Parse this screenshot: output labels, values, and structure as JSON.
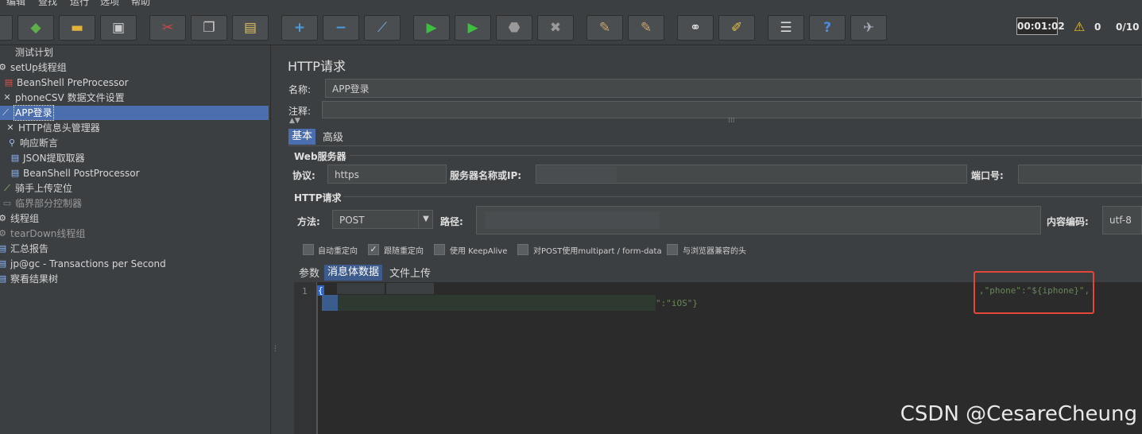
{
  "menu": {
    "items": [
      "编辑",
      "查找",
      "运行",
      "选项",
      "帮助"
    ]
  },
  "toolbar": {
    "buttons": [
      "new-icon",
      "templates-icon",
      "open-icon",
      "save-icon",
      "cut-icon",
      "copy-icon",
      "paste-icon",
      "expand-icon",
      "collapse-icon",
      "toggle-icon",
      "start-icon",
      "start-no-pause-icon",
      "stop-icon",
      "shutdown-icon",
      "clear-icon",
      "clear-all-icon",
      "search-icon",
      "reset-search-icon",
      "function-helper-icon",
      "help-icon",
      "remote-icon"
    ],
    "timer": "00:01:02",
    "warnings": "0",
    "threads": "0/10"
  },
  "tree": {
    "items": [
      {
        "label": "测试计划",
        "icon": "test-plan-icon"
      },
      {
        "label": "setUp线程组",
        "icon": "gear-icon"
      },
      {
        "label": "BeanShell PreProcessor",
        "icon": "script-icon"
      },
      {
        "label": "phoneCSV 数据文件设置",
        "icon": "tools-icon"
      },
      {
        "label": "APP登录",
        "icon": "pipette-icon",
        "selected": true
      },
      {
        "label": "HTTP信息头管理器",
        "icon": "tools-icon"
      },
      {
        "label": "响应断言",
        "icon": "magnifier-icon"
      },
      {
        "label": "JSON提取取器",
        "icon": "script-icon"
      },
      {
        "label": "BeanShell PostProcessor",
        "icon": "script-icon"
      },
      {
        "label": "骑手上传定位",
        "icon": "pipette-icon"
      },
      {
        "label": "临界部分控制器",
        "icon": "controller-icon"
      },
      {
        "label": "线程组",
        "icon": "gear-icon"
      },
      {
        "label": "tearDown线程组",
        "icon": "gear-icon"
      },
      {
        "label": "汇总报告",
        "icon": "report-icon"
      },
      {
        "label": "jp@gc - Transactions per Second",
        "icon": "report-icon"
      },
      {
        "label": "察看结果树",
        "icon": "report-icon"
      }
    ]
  },
  "panel": {
    "title": "HTTP请求",
    "name_label": "名称:",
    "name_value": "APP登录",
    "comment_label": "注释:",
    "tabs": [
      "基本",
      "高级"
    ],
    "web_server_title": "Web服务器",
    "protocol_label": "协议:",
    "protocol_value": "https",
    "server_label": "服务器名称或IP:",
    "port_label": "端口号:",
    "http_request_title": "HTTP请求",
    "method_label": "方法:",
    "method_value": "POST",
    "path_label": "路径:",
    "encoding_label": "内容编码:",
    "encoding_value": "utf-8",
    "options": [
      {
        "label": "自动重定向",
        "checked": false
      },
      {
        "label": "跟随重定向",
        "checked": true
      },
      {
        "label": "使用 KeepAlive",
        "checked": false
      },
      {
        "label": "对POST使用multipart / form-data",
        "checked": false
      },
      {
        "label": "与浏览器兼容的头",
        "checked": false
      }
    ],
    "subtabs": [
      "参数",
      "消息体数据",
      "文件上传"
    ],
    "editor": {
      "line_number": "1",
      "line1_open": "{",
      "line1_tail": ",\"phone\":\"${iphone}\",",
      "line2_tail": "\":\"iOS\"}"
    }
  },
  "watermark": "CSDN @CesareCheung"
}
